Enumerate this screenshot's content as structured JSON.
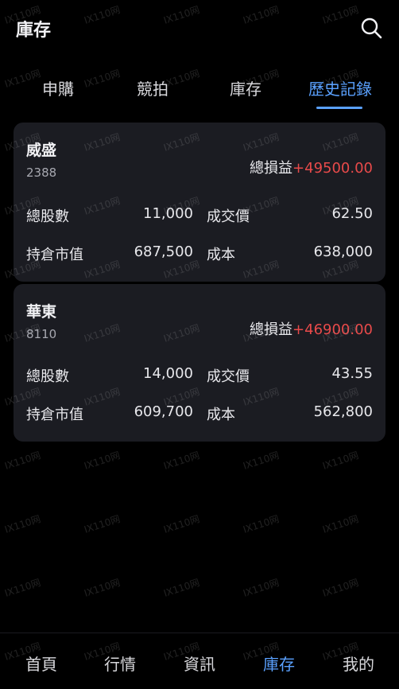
{
  "header": {
    "title": "庫存"
  },
  "tabs": [
    {
      "label": "申購"
    },
    {
      "label": "競拍"
    },
    {
      "label": "庫存"
    },
    {
      "label": "歷史記錄"
    }
  ],
  "active_tab_index": 3,
  "cards": [
    {
      "name": "威盛",
      "code": "2388",
      "pl_label": "總損益",
      "pl_value": "+49500.00",
      "total_shares_label": "總股數",
      "total_shares": "11,000",
      "deal_price_label": "成交價",
      "deal_price": "62.50",
      "market_value_label": "持倉市值",
      "market_value": "687,500",
      "cost_label": "成本",
      "cost": "638,000"
    },
    {
      "name": "華東",
      "code": "8110",
      "pl_label": "總損益",
      "pl_value": "+46900.00",
      "total_shares_label": "總股數",
      "total_shares": "14,000",
      "deal_price_label": "成交價",
      "deal_price": "43.55",
      "market_value_label": "持倉市值",
      "market_value": "609,700",
      "cost_label": "成本",
      "cost": "562,800"
    }
  ],
  "bottom_nav": [
    {
      "label": "首頁"
    },
    {
      "label": "行情"
    },
    {
      "label": "資訊"
    },
    {
      "label": "庫存"
    },
    {
      "label": "我的"
    }
  ],
  "active_nav_index": 3,
  "watermark_text": "IX110网",
  "colors": {
    "accent": "#5aa1ff",
    "profit": "#e84a4a",
    "card_bg": "#1b1c22",
    "background": "#000000"
  }
}
